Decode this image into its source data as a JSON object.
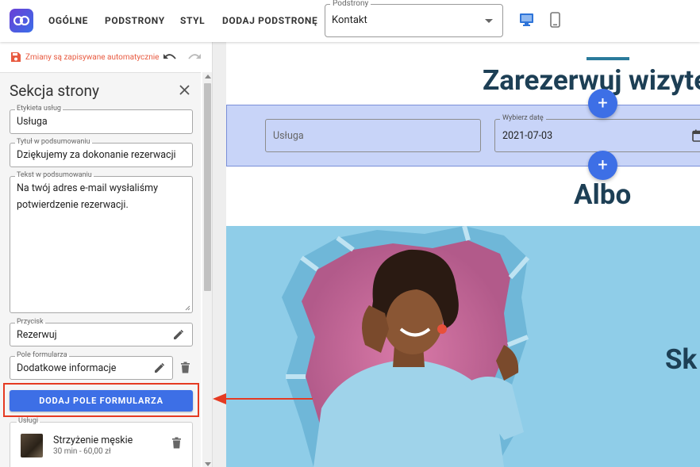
{
  "topbar": {
    "nav": [
      "OGÓLNE",
      "PODSTRONY",
      "STYL",
      "DODAJ PODSTRONĘ"
    ],
    "subpage_select": {
      "label": "Podstrony",
      "value": "Kontakt"
    },
    "accent_color": "#3d6fe6"
  },
  "panel": {
    "autosave": "Zmiany są zapisywane automatycznie",
    "title": "Sekcja strony",
    "fields": {
      "service_label": {
        "legend": "Etykieta usług",
        "value": "Usługa"
      },
      "summary_title": {
        "legend": "Tytuł w podsumowaniu",
        "value": "Dziękujemy za dokonanie rezerwacji"
      },
      "summary_text": {
        "legend": "Tekst w podsumowaniu",
        "line1": "Na twój adres e-mail wysłaliśmy",
        "line2": "potwierdzenie rezerwacji."
      },
      "button": {
        "legend": "Przycisk",
        "value": "Rezerwuj"
      },
      "form_field": {
        "legend": "Pole formularza",
        "value": "Dodatkowe informacje"
      }
    },
    "add_field_button": "DODAJ POLE FORMULARZA",
    "services": {
      "legend": "Usługi",
      "items": [
        {
          "name": "Strzyżenie męskie",
          "meta": "30 min - 60,00 zł"
        }
      ]
    }
  },
  "preview": {
    "heading": "Zarezerwuj wizytę",
    "service_placeholder": "Usługa",
    "date_legend": "Wybierz datę",
    "date_value": "2021-07-03",
    "plus": "+",
    "or_heading": "Albo",
    "hero_text": "Sk"
  },
  "colors": {
    "highlight": "#e53a22",
    "band": "#c8d4f8",
    "heading": "#1d3f55"
  }
}
